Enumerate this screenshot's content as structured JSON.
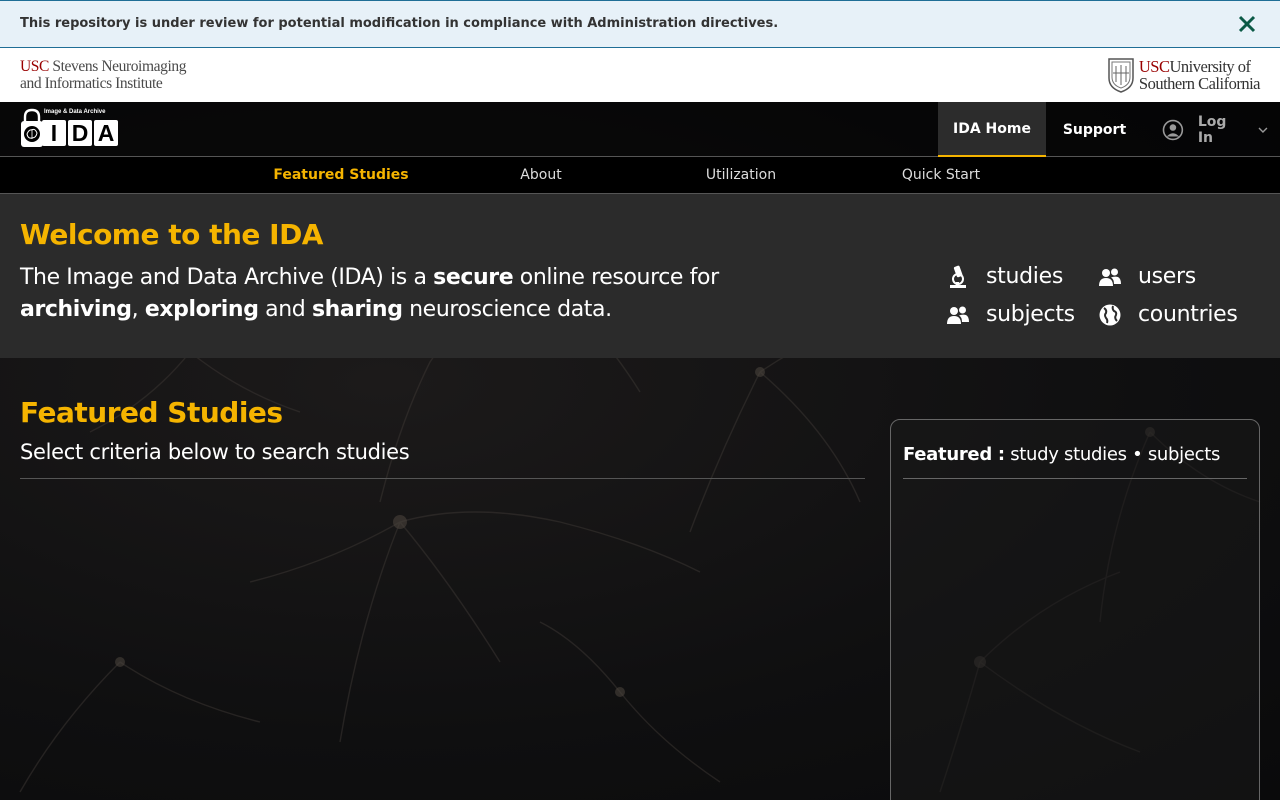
{
  "notice": {
    "text": "This repository is under review for potential modification in compliance with Administration directives.",
    "close_icon": "close-icon",
    "close_color": "#0b5a46"
  },
  "institute": {
    "left_prefix": "USC",
    "left_line1": " Stevens Neuroimaging",
    "left_line2": "and Informatics Institute",
    "right_prefix": "USC",
    "right_line1": "University of",
    "right_line2": "Southern California"
  },
  "logo": {
    "tagline": "Image & Data Archive",
    "letters": [
      "I",
      "D",
      "A"
    ]
  },
  "topnav": {
    "home": "IDA Home",
    "support": "Support",
    "login": "Log In"
  },
  "subnav": {
    "items": [
      "Featured Studies",
      "About",
      "Utilization",
      "Quick Start"
    ],
    "active_index": 0
  },
  "welcome": {
    "title": "Welcome to the IDA",
    "desc_1": "The Image and Data Archive (IDA) is a ",
    "desc_secure": "secure",
    "desc_2": " online resource for",
    "desc_archiving": "archiving",
    "desc_3": ", ",
    "desc_exploring": "exploring",
    "desc_4": " and ",
    "desc_sharing": "sharing",
    "desc_5": " neuroscience data."
  },
  "stats": {
    "studies": "studies",
    "users": "users",
    "subjects": "subjects",
    "countries": "countries"
  },
  "featured": {
    "title": "Featured Studies",
    "subtitle": "Select criteria below to search studies",
    "panel_label": "Featured :",
    "panel_text": " study studies • subjects"
  },
  "colors": {
    "accent": "#f5b400",
    "banner_bg": "#e7f1f8",
    "usc_red": "#990000"
  }
}
